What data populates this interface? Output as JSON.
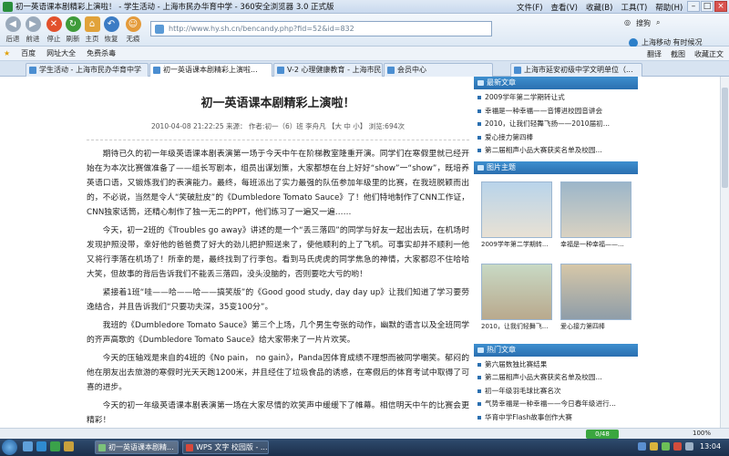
{
  "window": {
    "title": "初一英语课本剧精彩上演啦！ - 学生活动 - 上海市民办华育中学 - 360安全浏览器 3.0 正式版",
    "menus": [
      "文件(F)",
      "查看(V)",
      "收藏(B)",
      "工具(T)",
      "帮助(H)"
    ]
  },
  "toolbar": {
    "back": "后退",
    "forward": "前进",
    "stop": "停止",
    "refresh": "刷新",
    "home": "主页",
    "restore": "恢复",
    "traceless": "无痕",
    "address": "http://www.hy.sh.cn/bencandy.php?fid=52&id=832",
    "search_hint": "搜狗",
    "isp": "上海移动 有时候况"
  },
  "favorites": {
    "star": "收藏",
    "items": [
      "百度",
      "网址大全",
      "免费杀毒"
    ],
    "right": [
      "翻译",
      "截图",
      "收藏正文"
    ]
  },
  "tabs": [
    "学生活动 - 上海市民办华育中学",
    "初一英语课本剧精彩上演啦...",
    "V-2 心理健康教育 - 上海市民办...",
    "会员中心",
    "上海市延安初级中学文明单位（..."
  ],
  "article": {
    "title": "初一英语课本剧精彩上演啦！",
    "meta": "2010-04-08 21:22:25 来源： 作者:初一（6）班 李舟凡 【大 中 小】 浏览:694次",
    "paragraphs": [
      "期待已久的初一年级英语课本剧表演第一场于今天中午在阶梯教室隆重开演。同学们在寒假里就已经开始在为本次比赛做准备了——组长写剧本，组员出谋划策，大家都想在台上好好“show”一“show”，既培养英语口语，又锻炼我们的表演能力。最终，每班派出了实力最强的队伍参加年级里的比赛，在我班脱颖而出的，不必说，当然是令人“笑破肚皮”的《Dumbledore Tomato Sauce》了！他们特地制作了CNN工作证，CNN独家话筒，还精心制作了独一无二的PPT，他们练习了一遍又一遍……",
      "今天，初一2班的《Troubles go away》讲述的是一个“丢三落四”的同学与好友一起出去玩，在机场时发现护照没带，幸好他的爸爸费了好大的劲儿把护照送来了，使他顺利的上了飞机。可事实却并不顺利一他又将行李落在机场了！所幸的是，最终找到了行李包。看到马氏虎虎的同学焦急的神情，大家都忍不住哈哈大笑，但故事的背后告诉我们不能丢三落四，没头没脑的，否则要吃大亏的哟！",
      "紧接着1班“哇——哈——哈——搞笑版”的《Good good study, day day up》让我们知道了学习要劳逸结合，并且告诉我们“只要功夫深，35变100分”。",
      "我班的《Dumbledore Tomato Sauce》第三个上场，几个男生夸张的动作，幽默的语言以及全班同学的齐声高歌的《Dumbledore Tomato Sauce》给大家带来了一片片欢笑。",
      "今天的压轴戏是来自的4班的《No pain， no gain》，Panda因体育成绩不理想而被同学嘲笑。郁闷的他在朋友出去旅游的寒假时光天天跑1200米，并且经住了垃圾食品的诱惑，在寒假后的体育考试中取得了可喜的进步。",
      "今天的初一年级英语课本剧表演第一场在大家尽情的欢笑声中缓缓下了帷幕。相信明天中午的比赛会更精彩！"
    ]
  },
  "sidebar": {
    "news_head": "最新文章",
    "news": [
      "2009学年第二学期转让式",
      "幸福是一种幸福——音博进校园音讲会",
      "2010，让我们轻舞飞扬——2010届初...",
      "爱心接力第四棒",
      "第二届相声小品大赛获奖名单及校园..."
    ],
    "pics_head": "图片主题",
    "pics": [
      "2009学年第二学期转...",
      "幸福是一种幸福——...",
      "2010，让我们轻舞飞...",
      "爱心接力第四棒"
    ],
    "hot_head": "热门文章",
    "hot": [
      "第六届数独比赛结果",
      "第二届相声小品大赛获奖名单及校园...",
      "初一年级羽毛球比赛名次",
      "气势幸福是一种幸福——今日春年级进行...",
      "华育中学Flash故事创作大赛"
    ]
  },
  "status": {
    "downloads": "0/48",
    "zoom": "100%"
  },
  "taskbar": {
    "tasks": [
      "初一英语课本剧精...",
      "WPS 文字 校园版 - ..."
    ],
    "clock": "13:04"
  },
  "colors": {
    "accent": "#2a6fb0",
    "tabbar": "#d7e3f1",
    "taskbar": "#1b2f4b"
  }
}
